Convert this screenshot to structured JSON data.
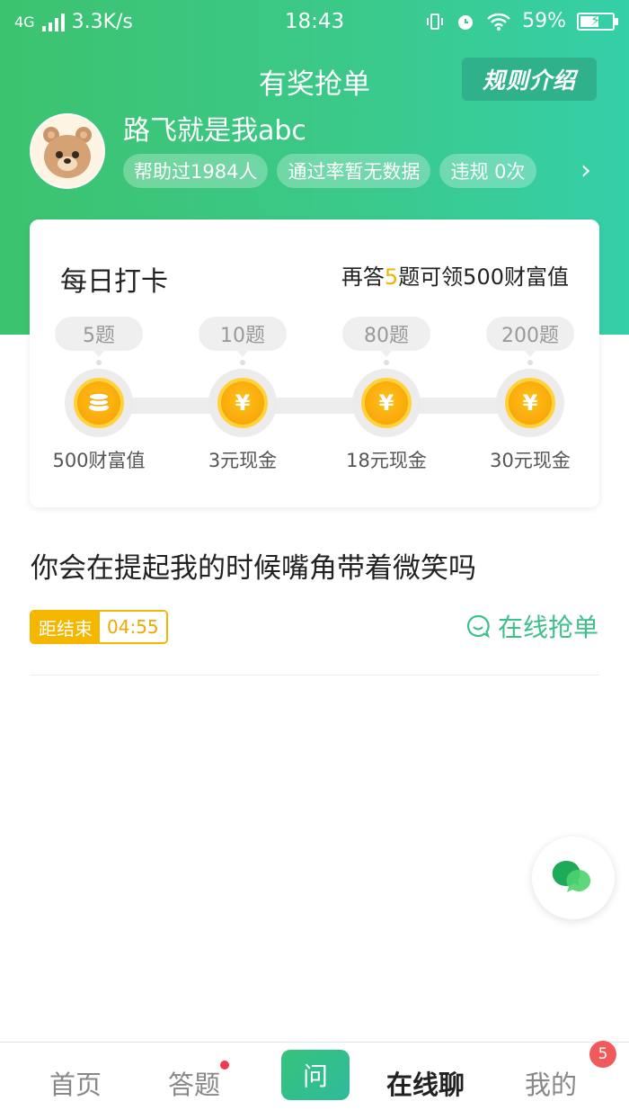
{
  "status_bar": {
    "network": "4G",
    "speed": "3.3K/s",
    "time": "18:43",
    "battery": "59%",
    "battery_level": 0.59
  },
  "header": {
    "title": "有奖抢单",
    "rules_label": "规则介绍"
  },
  "profile": {
    "username": "路飞就是我abc",
    "badges": [
      "帮助过1984人",
      "通过率暂无数据",
      "违规 0次"
    ]
  },
  "checkin": {
    "title": "每日打卡",
    "tip_prefix": "再答",
    "tip_count": "5",
    "tip_suffix": "题可领500财富值",
    "steps": [
      {
        "questions": "5题",
        "reward": "500财富值",
        "icon": "coin-stack-icon"
      },
      {
        "questions": "10题",
        "reward": "3元现金",
        "icon": "yen-coin-icon"
      },
      {
        "questions": "80题",
        "reward": "18元现金",
        "icon": "yen-coin-icon"
      },
      {
        "questions": "200题",
        "reward": "30元现金",
        "icon": "yen-coin-icon"
      }
    ]
  },
  "question": {
    "text": "你会在提起我的时候嘴角带着微笑吗",
    "timer_label": "距结束",
    "timer_value": "04:55",
    "grab_label": "在线抢单"
  },
  "tabbar": {
    "home": "首页",
    "answer": "答题",
    "ask": "问",
    "chat": "在线聊",
    "mine": "我的",
    "mine_badge": "5"
  },
  "colors": {
    "brand_green": "#3bc98a",
    "accent_yellow": "#f5b600",
    "badge_red": "#f05a5a"
  }
}
